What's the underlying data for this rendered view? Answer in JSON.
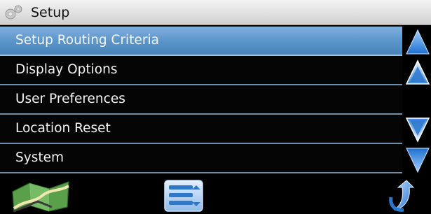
{
  "header": {
    "title": "Setup",
    "icon": "gear-icon"
  },
  "menu": {
    "items": [
      {
        "label": "Setup Routing Criteria",
        "selected": true
      },
      {
        "label": "Display Options",
        "selected": false
      },
      {
        "label": "User Preferences",
        "selected": false
      },
      {
        "label": "Location Reset",
        "selected": false
      },
      {
        "label": "System",
        "selected": false
      }
    ]
  },
  "scrollbar": {
    "buttons": [
      "page-up-icon",
      "line-up-icon",
      "line-down-icon",
      "page-down-icon"
    ]
  },
  "bottom_bar": {
    "buttons": [
      "map-icon",
      "list-icon",
      "back-arrow-icon"
    ]
  },
  "colors": {
    "selected_row": "#5a94c8",
    "arrow_blue": "#2f7fd6",
    "row_divider": "#6e8fa8"
  }
}
